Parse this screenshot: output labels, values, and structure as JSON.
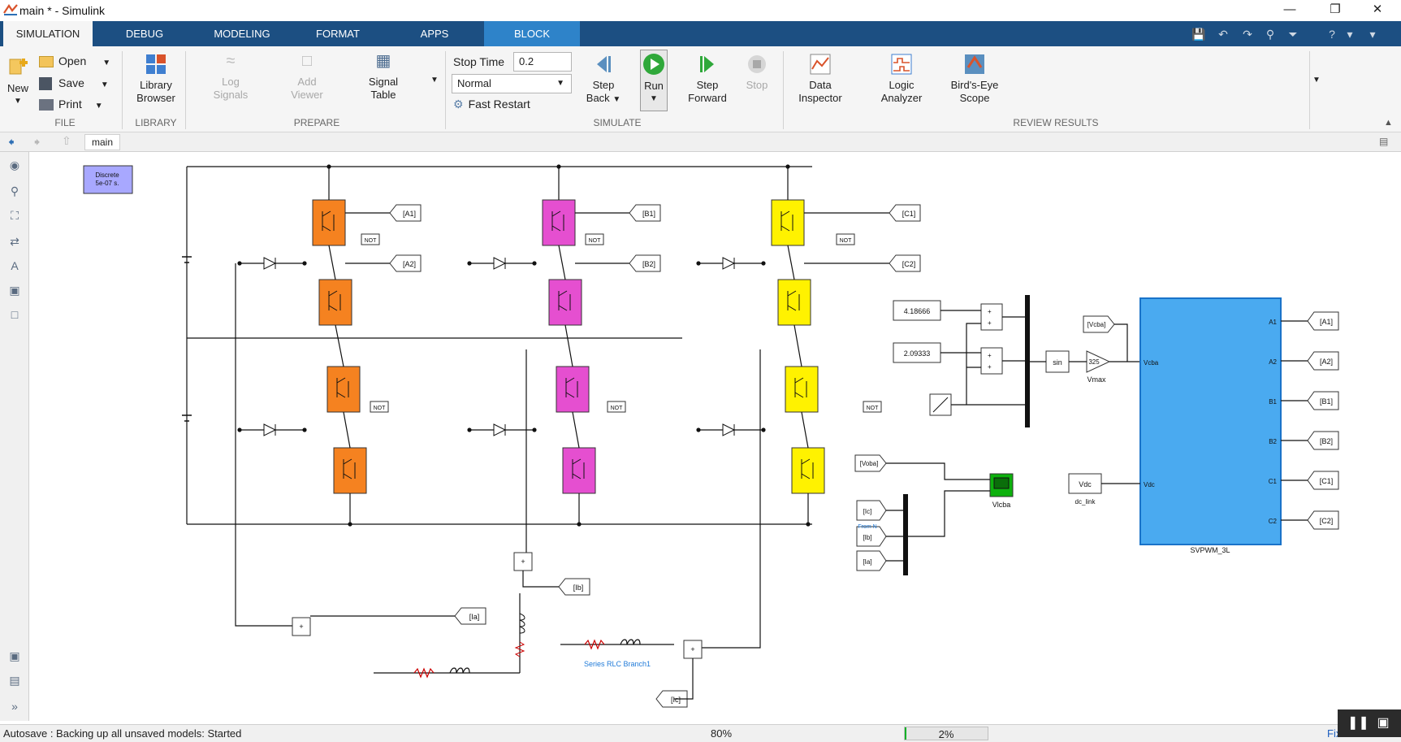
{
  "window": {
    "title": "main * - Simulink"
  },
  "tabs": [
    {
      "label": "SIMULATION",
      "state": "active"
    },
    {
      "label": "DEBUG"
    },
    {
      "label": "MODELING"
    },
    {
      "label": "FORMAT"
    },
    {
      "label": "APPS"
    },
    {
      "label": "BLOCK",
      "state": "contextual"
    }
  ],
  "ribbon": {
    "file": {
      "group_label": "FILE",
      "new_label": "New",
      "open_label": "Open",
      "save_label": "Save",
      "print_label": "Print"
    },
    "library": {
      "group_label": "LIBRARY",
      "library_browser_line1": "Library",
      "library_browser_line2": "Browser"
    },
    "prepare": {
      "group_label": "PREPARE",
      "log_signals_line1": "Log",
      "log_signals_line2": "Signals",
      "add_viewer_line1": "Add",
      "add_viewer_line2": "Viewer",
      "signal_table_line1": "Signal",
      "signal_table_line2": "Table"
    },
    "simulate": {
      "group_label": "SIMULATE",
      "stop_time_label": "Stop Time",
      "stop_time_value": "0.2",
      "mode_value": "Normal",
      "fast_restart_label": "Fast Restart",
      "step_back_line1": "Step",
      "step_back_line2": "Back",
      "run_label": "Run",
      "step_forward_line1": "Step",
      "step_forward_line2": "Forward",
      "stop_label": "Stop"
    },
    "review": {
      "group_label": "REVIEW RESULTS",
      "data_inspector_line1": "Data",
      "data_inspector_line2": "Inspector",
      "logic_analyzer_line1": "Logic",
      "logic_analyzer_line2": "Analyzer",
      "birds_eye_line1": "Bird's-Eye",
      "birds_eye_line2": "Scope"
    }
  },
  "address": {
    "breadcrumb": "main"
  },
  "model": {
    "powergui": {
      "line1": "Discrete",
      "line2": "5e-07 s."
    },
    "goto_tags": [
      "[A1]",
      "[A2]",
      "[B1]",
      "[B2]",
      "[C1]",
      "[C2]"
    ],
    "not_label": "NOT",
    "constants": [
      "4.18666",
      "2.09333"
    ],
    "sin_label": "sin",
    "gain_value": "325",
    "gain_name": "Vmax",
    "from_vcba": "[Vcba]",
    "subsystem": {
      "name": "SVPWM_3L",
      "in_ports": [
        "Vcba",
        "Vdc"
      ],
      "out_ports": [
        "A1",
        "A2",
        "B1",
        "B2",
        "C1",
        "C2"
      ]
    },
    "vdc_block": {
      "label": "Vdc",
      "name": "dc_link"
    },
    "scope_name": "Vlcba",
    "from_tags": [
      "[Ic]",
      "[Ib]",
      "[Ia]"
    ],
    "from_hint": "From N",
    "meas_tags": [
      "[Ia]",
      "[Ib]",
      "[Ic]"
    ],
    "rlc_name": "Series RLC Branch1"
  },
  "status": {
    "message": "Autosave : Backing up all unsaved models: Started",
    "zoom": "80%",
    "progress_text": "2%",
    "progress_value": 0.02,
    "solver": "Fix"
  },
  "colors": {
    "tabstrip": "#1c4f82",
    "block_tab": "#2e83c9",
    "phase_a": "#f58220",
    "phase_b": "#e54fd0",
    "phase_c": "#fff200",
    "subsystem": "#4aaaf0",
    "scope": "#0db10d",
    "powergui": "#a8a8ff"
  }
}
